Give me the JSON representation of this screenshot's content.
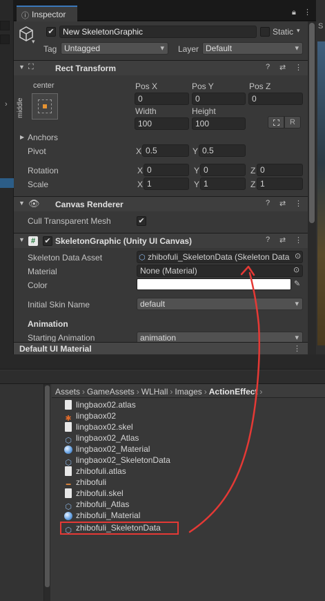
{
  "inspector": {
    "tab_label": "Inspector",
    "object": {
      "name": "New SkeletonGraphic",
      "static_label": "Static",
      "tag_label": "Tag",
      "tag_value": "Untagged",
      "layer_label": "Layer",
      "layer_value": "Default"
    },
    "rect_transform": {
      "title": "Rect Transform",
      "anchor_h": "center",
      "anchor_v": "middle",
      "pos_x_label": "Pos X",
      "pos_y_label": "Pos Y",
      "pos_z_label": "Pos Z",
      "pos_x": "0",
      "pos_y": "0",
      "pos_z": "0",
      "width_label": "Width",
      "height_label": "Height",
      "width": "100",
      "height": "100",
      "r_button": "R",
      "anchors_label": "Anchors",
      "pivot_label": "Pivot",
      "pivot_x": "0.5",
      "pivot_y": "0.5",
      "rotation_label": "Rotation",
      "rotation_x": "0",
      "rotation_y": "0",
      "rotation_z": "0",
      "scale_label": "Scale",
      "scale_x": "1",
      "scale_y": "1",
      "scale_z": "1",
      "x": "X",
      "y": "Y",
      "z": "Z"
    },
    "canvas_renderer": {
      "title": "Canvas Renderer",
      "cull_label": "Cull Transparent Mesh",
      "cull_checked": true
    },
    "skeleton_graphic": {
      "title": "SkeletonGraphic (Unity UI Canvas)",
      "skeleton_data_label": "Skeleton Data Asset",
      "skeleton_data_value": "zhibofuli_SkeletonData (Skeleton Data",
      "material_label": "Material",
      "material_value": "None (Material)",
      "color_label": "Color",
      "color_value": "#ffffff",
      "initial_skin_label": "Initial Skin Name",
      "initial_skin_value": "default",
      "animation_section": "Animation",
      "starting_animation_label": "Starting Animation",
      "starting_animation_value": "animation"
    },
    "footer_material": "Default UI Material"
  },
  "project": {
    "breadcrumbs": [
      "Assets",
      "GameAssets",
      "WLHall",
      "Images",
      "ActionEffect"
    ],
    "files": [
      {
        "name": "lingbaox02.atlas",
        "icon": "text-document-icon"
      },
      {
        "name": "lingbaox02",
        "icon": "texture-icon"
      },
      {
        "name": "lingbaox02.skel",
        "icon": "text-document-icon"
      },
      {
        "name": "lingbaox02_Atlas",
        "icon": "atlas-asset-icon"
      },
      {
        "name": "lingbaox02_Material",
        "icon": "material-sphere-icon"
      },
      {
        "name": "lingbaox02_SkeletonData",
        "icon": "skeleton-data-icon"
      },
      {
        "name": "zhibofuli.atlas",
        "icon": "text-document-icon"
      },
      {
        "name": "zhibofuli",
        "icon": "texture-icon"
      },
      {
        "name": "zhibofuli.skel",
        "icon": "text-document-icon"
      },
      {
        "name": "zhibofuli_Atlas",
        "icon": "atlas-asset-icon"
      },
      {
        "name": "zhibofuli_Material",
        "icon": "material-sphere-icon"
      },
      {
        "name": "zhibofuli_SkeletonData",
        "icon": "skeleton-data-icon"
      }
    ]
  },
  "colors": {
    "annotation": "#e53935",
    "tab_accent": "#3a79bb"
  }
}
